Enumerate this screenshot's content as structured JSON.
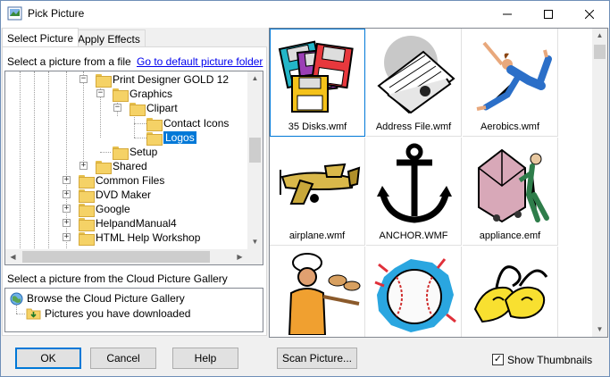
{
  "window": {
    "title": "Pick Picture",
    "minimize": "—",
    "maximize": "☐",
    "close": "✕"
  },
  "tabs": [
    {
      "label": "Select Picture",
      "active": true
    },
    {
      "label": "Apply Effects",
      "active": false
    }
  ],
  "file_section": {
    "label": "Select a picture from a file",
    "link": "Go to default picture folder"
  },
  "tree": {
    "items": [
      {
        "label": "Print Designer GOLD 12",
        "expander": "−"
      },
      {
        "label": "Graphics",
        "expander": "−"
      },
      {
        "label": "Clipart",
        "expander": "−"
      },
      {
        "label": "Contact Icons",
        "expander": ""
      },
      {
        "label": "Logos",
        "expander": "",
        "selected": true
      },
      {
        "label": "Setup",
        "expander": ""
      },
      {
        "label": "Shared",
        "expander": "+"
      },
      {
        "label": "Common Files",
        "expander": "+"
      },
      {
        "label": "DVD Maker",
        "expander": "+"
      },
      {
        "label": "Google",
        "expander": "+"
      },
      {
        "label": "HelpandManual4",
        "expander": "+"
      },
      {
        "label": "HTML Help Workshop",
        "expander": "+"
      }
    ]
  },
  "cloud_section": {
    "label": "Select a picture from the Cloud Picture Gallery",
    "items": [
      {
        "label": "Browse the Cloud Picture Gallery",
        "icon": "globe-icon"
      },
      {
        "label": "Pictures you have downloaded",
        "icon": "download-folder-icon"
      }
    ]
  },
  "thumbnails": [
    {
      "label": "35 Disks.wmf",
      "icon": "floppy-disks-icon",
      "selected": true
    },
    {
      "label": "Address File.wmf",
      "icon": "rolodex-icon"
    },
    {
      "label": "Aerobics.wmf",
      "icon": "aerobics-dancer-icon"
    },
    {
      "label": "airplane.wmf",
      "icon": "airplane-icon"
    },
    {
      "label": "ANCHOR.WMF",
      "icon": "anchor-icon"
    },
    {
      "label": "appliance.emf",
      "icon": "appliance-dolly-icon"
    },
    {
      "label": "",
      "icon": "baker-icon"
    },
    {
      "label": "",
      "icon": "baseball-icon"
    },
    {
      "label": "",
      "icon": "ballet-shoes-icon"
    }
  ],
  "buttons": {
    "ok": "OK",
    "cancel": "Cancel",
    "help": "Help",
    "scan": "Scan Picture..."
  },
  "show_thumbnails": {
    "label": "Show Thumbnails",
    "checked": true,
    "mark": "✓"
  }
}
